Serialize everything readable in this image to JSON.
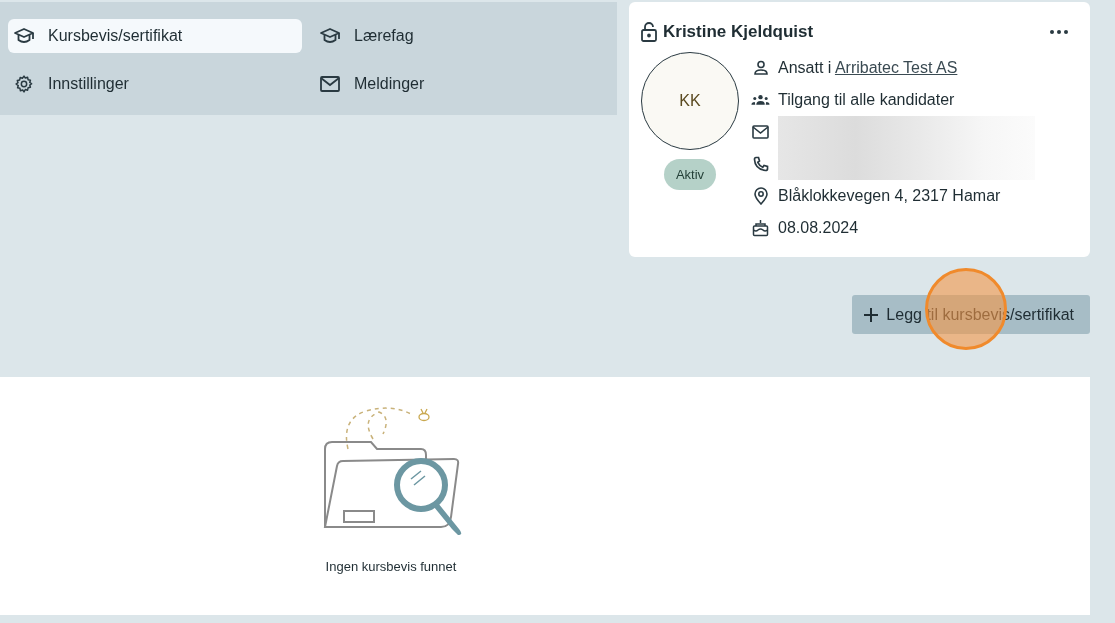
{
  "nav": {
    "items": [
      {
        "label": "Kursbevis/sertifikat",
        "kind": "courses",
        "selected": true
      },
      {
        "label": "Lærefag",
        "kind": "subjects",
        "selected": false
      },
      {
        "label": "Innstillinger",
        "kind": "settings",
        "selected": false
      },
      {
        "label": "Meldinger",
        "kind": "messages",
        "selected": false
      }
    ]
  },
  "profile": {
    "name": "Kristine Kjeldquist",
    "initials": "KK",
    "status": "Aktiv",
    "details": [
      {
        "kind": "employer",
        "prefix": "Ansatt i",
        "link": "Arribatec Test AS"
      },
      {
        "kind": "access",
        "text": "Tilgang til alle kandidater"
      },
      {
        "kind": "email"
      },
      {
        "kind": "phone"
      },
      {
        "kind": "address",
        "text": "Blåklokkevegen 4, 2317 Hamar"
      },
      {
        "kind": "birthday",
        "text": "08.08.2024"
      }
    ]
  },
  "add_button": {
    "label": "Legg til kursbevis/sertifikat",
    "click_highlight": true
  },
  "empty_state": {
    "message": "Ingen kursbevis funnet"
  }
}
